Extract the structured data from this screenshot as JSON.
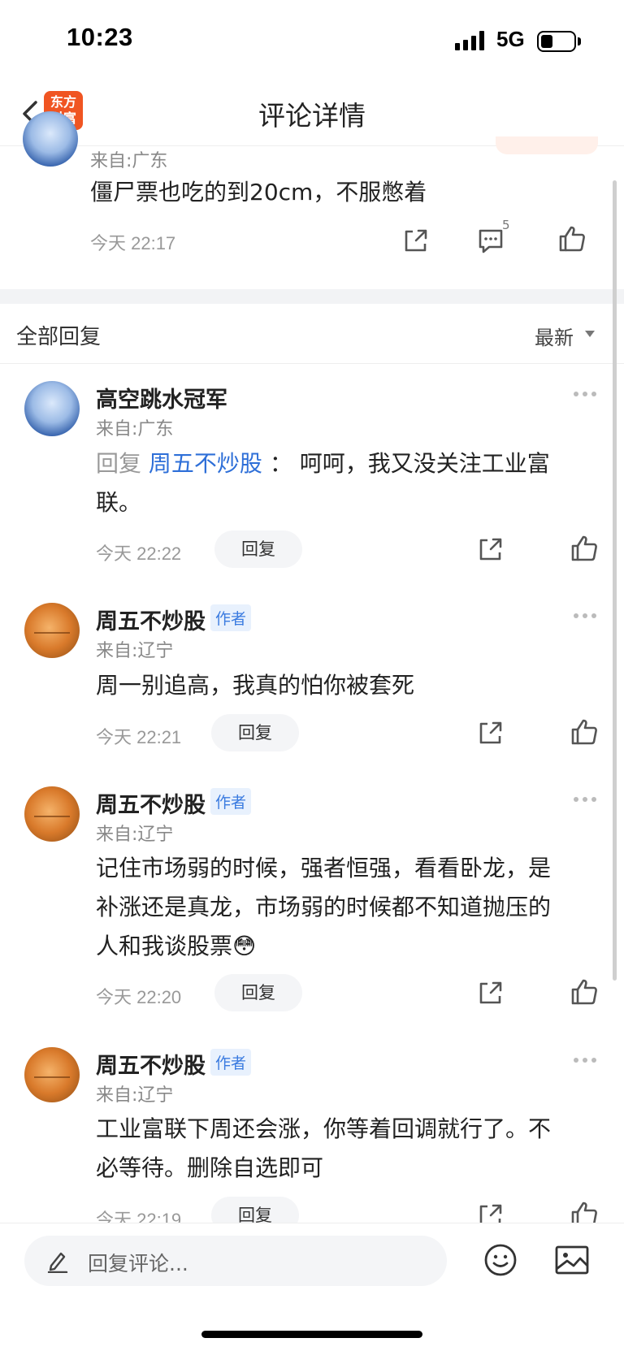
{
  "status_bar": {
    "time": "10:23",
    "network": "5G"
  },
  "header": {
    "title": "评论详情",
    "logo_line1": "东方",
    "logo_line2": "财富"
  },
  "main_comment": {
    "from": "来自:广东",
    "content": "僵尸票也吃的到20cm，不服憋着",
    "time": "今天 22:17",
    "comment_count": "5"
  },
  "section": {
    "title": "全部回复",
    "sort": "最新"
  },
  "replies": [
    {
      "name": "高空跳水冠军",
      "badge": "",
      "from": "来自:广东",
      "prefix": "回复",
      "mention": "周五不炒股",
      "separator": "：",
      "line1": "呵呵，我又没关注工业富",
      "line2": "联。",
      "line3": "",
      "time": "今天 22:22",
      "reply_label": "回复"
    },
    {
      "name": "周五不炒股",
      "badge": "作者",
      "from": "来自:辽宁",
      "line1": "周一别追高，我真的怕你被套死",
      "line2": "",
      "line3": "",
      "time": "今天 22:21",
      "reply_label": "回复"
    },
    {
      "name": "周五不炒股",
      "badge": "作者",
      "from": "来自:辽宁",
      "line1": "记住市场弱的时候，强者恒强，看看卧龙，是",
      "line2": "补涨还是真龙，市场弱的时候都不知道抛压的",
      "line3": "人和我谈股票😳",
      "time": "今天 22:20",
      "reply_label": "回复"
    },
    {
      "name": "周五不炒股",
      "badge": "作者",
      "from": "来自:辽宁",
      "line1": "工业富联下周还会涨，你等着回调就行了。不",
      "line2": "必等待。删除自选即可",
      "line3": "",
      "time": "今天 22:19",
      "reply_label": "回复"
    }
  ],
  "bottom_bar": {
    "placeholder": "回复评论..."
  },
  "icons": {
    "back": "back-arrow-icon",
    "share": "share-icon",
    "comment": "comment-icon",
    "like": "thumbs-up-icon",
    "more": "more-dots-icon",
    "pen": "pen-icon",
    "emoji": "emoji-icon",
    "image": "image-icon"
  },
  "colors": {
    "accent": "#2e6fd8",
    "brand": "#f05522",
    "author_badge_bg": "#e8f1fd"
  }
}
